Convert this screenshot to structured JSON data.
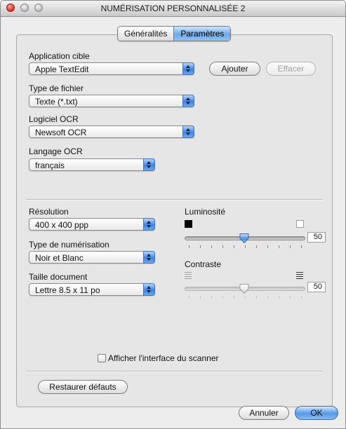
{
  "window": {
    "title": "NUMÉRISATION PERSONNALISÉE 2"
  },
  "tabs": [
    {
      "label": "Généralités",
      "active": false
    },
    {
      "label": "Paramètres",
      "active": true
    }
  ],
  "app_section": {
    "label": "Application cible",
    "value": "Apple TextEdit",
    "add_label": "Ajouter",
    "remove_label": "Effacer"
  },
  "file_type": {
    "label": "Type de fichier",
    "value": "Texte (*.txt)"
  },
  "ocr_software": {
    "label": "Logiciel OCR",
    "value": "Newsoft OCR"
  },
  "ocr_language": {
    "label": "Langage OCR",
    "value": "français"
  },
  "resolution": {
    "label": "Résolution",
    "value": "400 x 400 ppp"
  },
  "scan_type": {
    "label": "Type de numérisation",
    "value": "Noir et Blanc"
  },
  "document_size": {
    "label": "Taille document",
    "value": "Lettre  8.5 x 11 po"
  },
  "brightness": {
    "label": "Luminosité",
    "value": "50",
    "level_percent": 50
  },
  "contrast": {
    "label": "Contraste",
    "value": "50",
    "level_percent": 50,
    "enabled": false
  },
  "show_scanner_interface": {
    "label": "Afficher l'interface du scanner",
    "checked": false
  },
  "buttons": {
    "restore_defaults": "Restaurer défauts",
    "cancel": "Annuler",
    "ok": "OK"
  },
  "colors": {
    "accent_blue": "#5598e6",
    "window_bg": "#ededed"
  }
}
